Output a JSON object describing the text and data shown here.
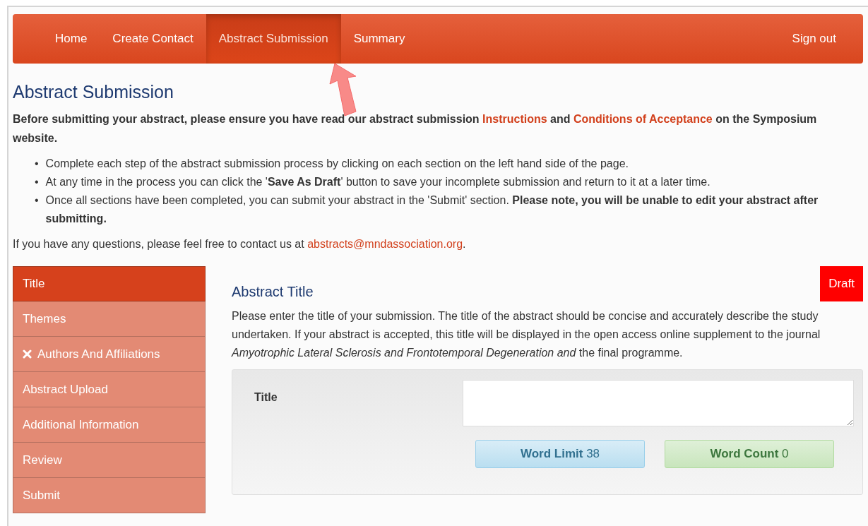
{
  "navbar": {
    "items": [
      {
        "label": "Home",
        "selected": false
      },
      {
        "label": "Create Contact",
        "selected": false
      },
      {
        "label": "Abstract Submission",
        "selected": true
      },
      {
        "label": "Summary",
        "selected": false
      }
    ],
    "sign_out": "Sign out"
  },
  "heading": "Abstract Submission",
  "intro": {
    "parts": [
      {
        "kind": "text",
        "text": "Before submitting your abstract, please ensure you have read our abstract submission "
      },
      {
        "kind": "link",
        "text": "Instructions"
      },
      {
        "kind": "text",
        "text": " and "
      },
      {
        "kind": "link",
        "text": "Conditions of Acceptance"
      },
      {
        "kind": "text",
        "text": " on the Symposium website."
      }
    ]
  },
  "bullets": [
    {
      "marker": "•",
      "text": "Complete each step of the abstract submission process by clicking on each section on the left hand side of the page."
    },
    {
      "marker": "•",
      "text": "At any time in the process you can click the '**Save As Draft**' button to save your incomplete submission and return to it at a later time."
    },
    {
      "marker": "•",
      "text": "Once all sections have been completed, you can submit your abstract in the 'Submit' section. **Please note, you will be unable to edit your abstract after submitting.**"
    }
  ],
  "contact": {
    "text": "If you have any questions, please feel free to contact us at ",
    "email": "abstracts@mndassociation.org",
    "end": "."
  },
  "sidebar": {
    "items": [
      {
        "label": "Title",
        "selected": true,
        "incomplete": false
      },
      {
        "label": "Themes",
        "selected": false,
        "incomplete": false
      },
      {
        "label": "Authors And Affiliations",
        "selected": false,
        "incomplete": true
      },
      {
        "label": "Abstract Upload",
        "selected": false,
        "incomplete": false
      },
      {
        "label": "Additional Information",
        "selected": false,
        "incomplete": false
      },
      {
        "label": "Review",
        "selected": false,
        "incomplete": false
      },
      {
        "label": "Submit",
        "selected": false,
        "incomplete": false
      }
    ]
  },
  "section": {
    "title": "Abstract Title",
    "status": "Draft",
    "description": "Please enter the title of your submission. The title of the abstract should be concise and accurately describe the study undertaken. If your abstract is accepted, this title will be displayed in the open access online supplement to the journal *Amyotrophic Lateral Sclerosis and Frontotemporal Degeneration and* the final programme.",
    "field_label": "Title",
    "word_limit": {
      "label": "Word Limit",
      "value": "38"
    },
    "word_count": {
      "label": "Word Count",
      "value": "0"
    }
  }
}
